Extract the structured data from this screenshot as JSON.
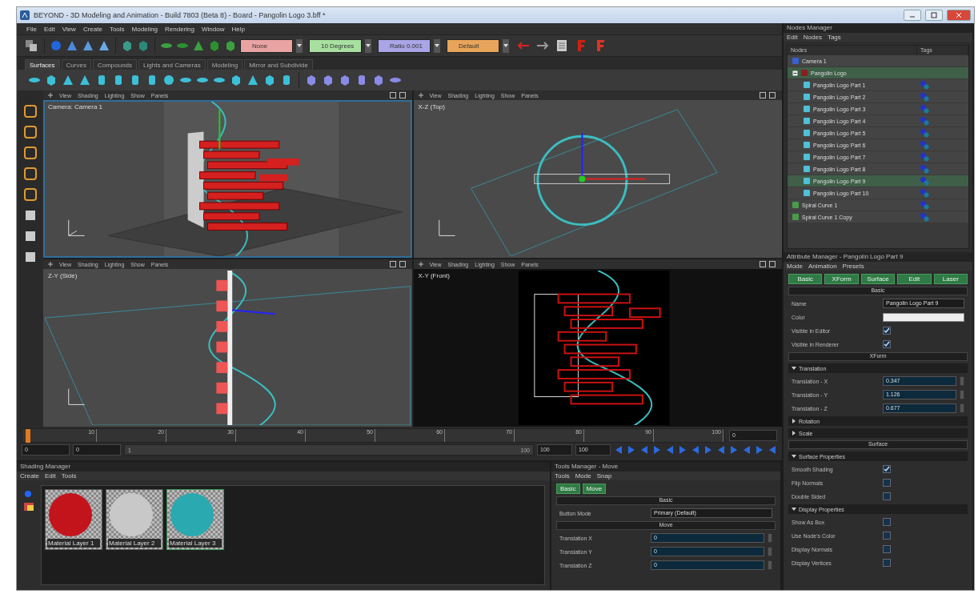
{
  "window": {
    "title": "BEYOND - 3D Modeling and Animation - Build 7803 (Beta 8) - Board - Pangolin Logo 3.bff *"
  },
  "menu": [
    "File",
    "Edit",
    "View",
    "Create",
    "Tools",
    "Modeling",
    "Rendering",
    "Window",
    "Help"
  ],
  "toolbar": {
    "dropdowns": [
      {
        "label": "None",
        "color": "#e9a3a3"
      },
      {
        "label": "10 Degrees",
        "color": "#a8e0a0"
      },
      {
        "label": "Ratio 0.001",
        "color": "#a9a5e6"
      },
      {
        "label": "Default",
        "color": "#e8a45a"
      }
    ]
  },
  "tabs": [
    {
      "label": "Surfaces",
      "selected": true
    },
    {
      "label": "Curves",
      "selected": false
    },
    {
      "label": "Compounds",
      "selected": false
    },
    {
      "label": "Lights and Cameras",
      "selected": false
    },
    {
      "label": "Modeling",
      "selected": false
    },
    {
      "label": "Mirror and Subdivide",
      "selected": false
    }
  ],
  "viewports": [
    {
      "kind": "perspective",
      "title": "Camera: Camera 1",
      "selected": true,
      "menu": [
        "View",
        "Shading",
        "Lighting",
        "Show",
        "Panels"
      ]
    },
    {
      "kind": "top",
      "title": "X-Z (Top)",
      "selected": false,
      "menu": [
        "View",
        "Shading",
        "Lighting",
        "Show",
        "Panels"
      ]
    },
    {
      "kind": "side",
      "title": "Z-Y (Side)",
      "selected": false,
      "menu": [
        "View",
        "Shading",
        "Lighting",
        "Show",
        "Panels"
      ]
    },
    {
      "kind": "front",
      "title": "X-Y (Front)",
      "selected": false,
      "menu": [
        "View",
        "Shading",
        "Lighting",
        "Show",
        "Panels"
      ]
    }
  ],
  "timeline": {
    "ticks": [
      "10",
      "20",
      "30",
      "40",
      "50",
      "60",
      "70",
      "80",
      "90",
      "100"
    ],
    "current_frame": "0",
    "start_fields": [
      "0",
      "0"
    ],
    "range": {
      "start": "1",
      "end": "100",
      "level": 1
    },
    "end_fields": [
      "100",
      "100"
    ]
  },
  "shading_manager": {
    "title": "Shading Manager",
    "menu": [
      "Create",
      "Edit",
      "Tools"
    ],
    "materials": [
      {
        "label": "Material Layer 1",
        "color": "#c3141c",
        "selected": false
      },
      {
        "label": "Material Layer 2",
        "color": "#c8c8c8",
        "selected": false
      },
      {
        "label": "Material Layer 3",
        "color": "#2aa9b0",
        "selected": true
      }
    ]
  },
  "tools_manager": {
    "title": "Tools Manager - Move",
    "menu": [
      "Tools",
      "Mode",
      "Snap"
    ],
    "tabs": [
      "Basic",
      "Move"
    ],
    "sections": [
      {
        "title": "Basic",
        "rows": [
          {
            "kind": "dropdown",
            "label": "Button Mode",
            "value": "Primary (Default)"
          }
        ]
      },
      {
        "title": "Move",
        "rows": [
          {
            "kind": "spin",
            "label": "Translation X",
            "value": "0"
          },
          {
            "kind": "spin",
            "label": "Translation Y",
            "value": "0"
          },
          {
            "kind": "spin",
            "label": "Translation Z",
            "value": "0"
          }
        ]
      }
    ]
  },
  "nodes_manager": {
    "title": "Nodes Manager",
    "menu": [
      "Edit",
      "Nodes",
      "Tags"
    ],
    "columns": [
      "Nodes",
      "Tags"
    ],
    "tree": [
      {
        "kind": "camera",
        "label": "Camera 1",
        "selected": false,
        "tagged": false
      },
      {
        "kind": "group",
        "label": "Pangolin Logo",
        "selected": true,
        "tagged": false,
        "expanded": true,
        "children": [
          {
            "kind": "surface",
            "label": "Pangolin Logo Part 1",
            "selected": false,
            "tagged": true
          },
          {
            "kind": "surface",
            "label": "Pangolin Logo Part 2",
            "selected": false,
            "tagged": true
          },
          {
            "kind": "surface",
            "label": "Pangolin Logo Part 3",
            "selected": false,
            "tagged": true
          },
          {
            "kind": "surface",
            "label": "Pangolin Logo Part 4",
            "selected": false,
            "tagged": true
          },
          {
            "kind": "surface",
            "label": "Pangolin Logo Part 5",
            "selected": false,
            "tagged": true
          },
          {
            "kind": "surface",
            "label": "Pangolin Logo Part 6",
            "selected": false,
            "tagged": true
          },
          {
            "kind": "surface",
            "label": "Pangolin Logo Part 7",
            "selected": false,
            "tagged": true
          },
          {
            "kind": "surface",
            "label": "Pangolin Logo Part 8",
            "selected": false,
            "tagged": true
          },
          {
            "kind": "surface",
            "label": "Pangolin Logo Part 9",
            "selected": true,
            "tagged": true
          },
          {
            "kind": "surface",
            "label": "Pangolin Logo Part 10",
            "selected": false,
            "tagged": true
          }
        ]
      },
      {
        "kind": "curve",
        "label": "Spiral Curve 1",
        "selected": false,
        "tagged": true
      },
      {
        "kind": "curve",
        "label": "Spiral Curve 1 Copy",
        "selected": false,
        "tagged": true
      }
    ]
  },
  "attribute_manager": {
    "title": "Attribute Manager - Pangolin Logo Part 9",
    "menu": [
      "Mode",
      "Animation",
      "Presets"
    ],
    "tabs": [
      "Basic",
      "XForm",
      "Surface",
      "Edit",
      "Laser"
    ],
    "sections": [
      {
        "title": "Basic",
        "groups": [
          {
            "rows": [
              {
                "kind": "text",
                "label": "Name",
                "value": "Pangolin Logo Part 9"
              },
              {
                "kind": "color",
                "label": "Color",
                "color": "#eeeeee"
              },
              {
                "kind": "checkbox",
                "label": "Visible in Editor",
                "checked": true
              },
              {
                "kind": "checkbox",
                "label": "Visible in Renderer",
                "checked": true
              }
            ]
          }
        ]
      },
      {
        "title": "XForm",
        "groups": [
          {
            "title": "Translation",
            "expanded": true,
            "rows": [
              {
                "kind": "spin",
                "label": "Translation - X",
                "value": "0.347"
              },
              {
                "kind": "spin",
                "label": "Translation - Y",
                "value": "1.126"
              },
              {
                "kind": "spin",
                "label": "Translation - Z",
                "value": "0.677"
              }
            ]
          },
          {
            "title": "Rotation",
            "expanded": false
          },
          {
            "title": "Scale",
            "expanded": false
          }
        ]
      },
      {
        "title": "Surface",
        "groups": [
          {
            "title": "Surface Properties",
            "expanded": true,
            "rows": [
              {
                "kind": "checkbox",
                "label": "Smooth Shading",
                "checked": true
              },
              {
                "kind": "checkbox",
                "label": "Flip Normals",
                "checked": false
              },
              {
                "kind": "checkbox",
                "label": "Double Sided",
                "checked": false
              }
            ]
          },
          {
            "title": "Display Properties",
            "expanded": true,
            "rows": [
              {
                "kind": "checkbox",
                "label": "Show As Box",
                "checked": false
              },
              {
                "kind": "checkbox",
                "label": "Use Node's Color",
                "checked": false
              },
              {
                "kind": "checkbox",
                "label": "Display Normals",
                "checked": false
              },
              {
                "kind": "checkbox",
                "label": "Display Vertices",
                "checked": false
              }
            ]
          }
        ]
      }
    ]
  }
}
